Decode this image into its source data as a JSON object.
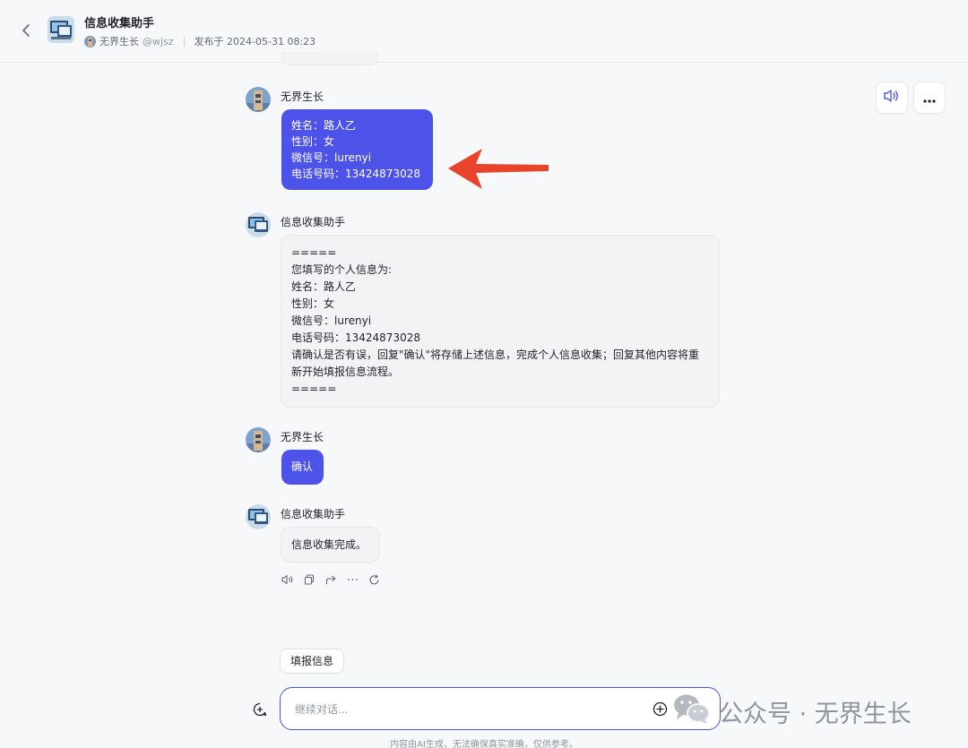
{
  "header": {
    "title": "信息收集助手",
    "author": "无界生长",
    "handle": "@wjsz",
    "published": "发布于 2024-05-31 08:23"
  },
  "messages": [
    {
      "role": "user",
      "name": "无界生长",
      "lines": [
        "姓名：路人乙",
        "性别：女",
        "微信号：lurenyi",
        "电话号码：13424873028"
      ]
    },
    {
      "role": "bot",
      "name": "信息收集助手",
      "lines": [
        "=====",
        "您填写的个人信息为:",
        "姓名：路人乙",
        "性别：女",
        "微信号：lurenyi",
        "电话号码：13424873028",
        "请确认是否有误，回复\"确认\"将存储上述信息，完成个人信息收集；回复其他内容将重新开始填报信息流程。",
        "====="
      ]
    },
    {
      "role": "user",
      "name": "无界生长",
      "lines": [
        "确认"
      ]
    },
    {
      "role": "bot",
      "name": "信息收集助手",
      "lines": [
        "信息收集完成。"
      ]
    }
  ],
  "suggestion": "填报信息",
  "input": {
    "placeholder": "继续对话..."
  },
  "watermark": {
    "text": "公众号 · 无界生长"
  },
  "footer": "内容由AI生成，无法确保真实准确，仅供参考。",
  "colors": {
    "accent": "#4d53e8",
    "annotation_arrow": "#e8442c"
  },
  "icons": [
    "back-chevron-icon",
    "speaker-icon",
    "more-icon",
    "copy-icon",
    "share-icon",
    "regenerate-icon",
    "new-chat-icon",
    "plus-circle-icon",
    "wechat-icon"
  ]
}
